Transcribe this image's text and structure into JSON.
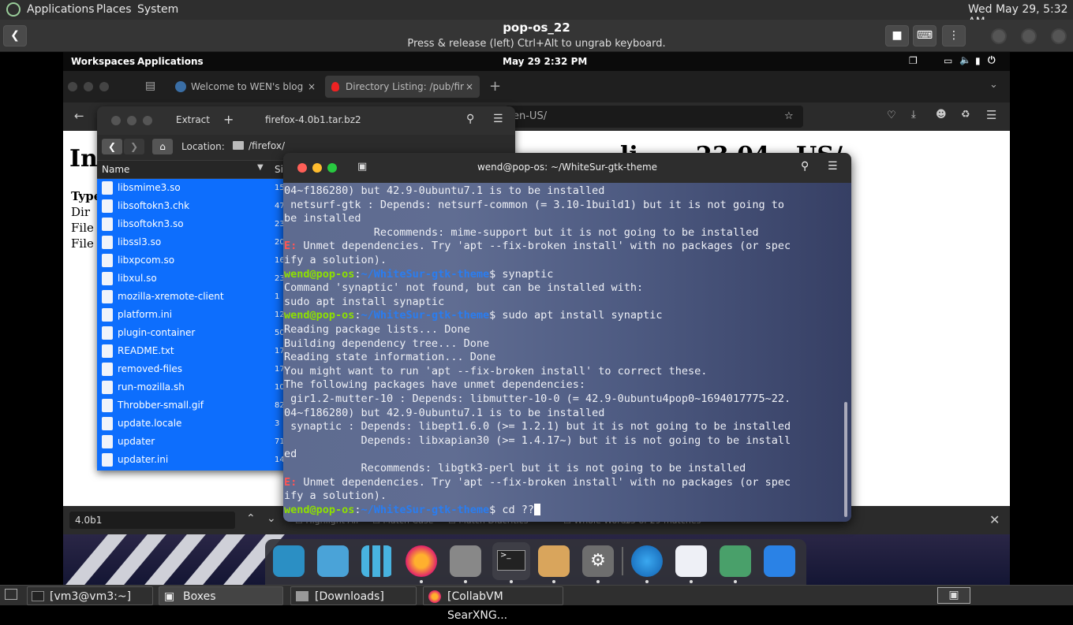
{
  "host_panel": {
    "menus": [
      "Applications",
      "Places",
      "System"
    ],
    "clock": "Wed May 29,  5:32 AM"
  },
  "boxes": {
    "title": "pop-os_22",
    "subtitle": "Press & release (left) Ctrl+Alt to ungrab keyboard."
  },
  "guest_panel": {
    "workspaces": "Workspaces",
    "applications": "Applications",
    "clock": "May 29   2:32 PM"
  },
  "firefox": {
    "tabs": [
      {
        "label": "Welcome to WEN's blog"
      },
      {
        "label": "Directory Listing: /pub/fir"
      }
    ],
    "url_tail": "en-US/",
    "page_heading_left": "In",
    "page_heading_right": "li       23.04 - US/",
    "type_label": "Type",
    "rows": [
      "Dir",
      "File",
      "File"
    ],
    "find": {
      "query": "4.0b1",
      "options": [
        "Highlight All",
        "Match Case",
        "Match Diacritics",
        "Whole Words"
      ],
      "count": "15 of 29 matches"
    }
  },
  "file_manager": {
    "extract_label": "Extract",
    "title": "firefox-4.0b1.tar.bz2",
    "location_label": "Location:",
    "location_path": "/firefox/",
    "col_name": "Name",
    "col_size": "Si",
    "files": [
      {
        "name": "libsmime3.so",
        "size": "15"
      },
      {
        "name": "libsoftokn3.chk",
        "size": "47"
      },
      {
        "name": "libsoftokn3.so",
        "size": "23"
      },
      {
        "name": "libssl3.so",
        "size": "20"
      },
      {
        "name": "libxpcom.so",
        "size": "16"
      },
      {
        "name": "libxul.so",
        "size": "23"
      },
      {
        "name": "mozilla-xremote-client",
        "size": "1"
      },
      {
        "name": "platform.ini",
        "size": "12"
      },
      {
        "name": "plugin-container",
        "size": "50"
      },
      {
        "name": "README.txt",
        "size": "17"
      },
      {
        "name": "removed-files",
        "size": "17"
      },
      {
        "name": "run-mozilla.sh",
        "size": "10"
      },
      {
        "name": "Throbber-small.gif",
        "size": "82"
      },
      {
        "name": "update.locale",
        "size": "3"
      },
      {
        "name": "updater",
        "size": "71"
      },
      {
        "name": "updater.ini",
        "size": "14"
      }
    ]
  },
  "terminal": {
    "title": "wend@pop-os: ~/WhiteSur-gtk-theme",
    "lines": [
      {
        "t": "04~f186280) but 42.9-0ubuntu7.1 is to be installed"
      },
      {
        "t": " netsurf-gtk : Depends: netsurf-common (= 3.10-1build1) but it is not going to"
      },
      {
        "t": "be installed"
      },
      {
        "t": "              Recommends: mime-support but it is not going to be installed"
      },
      {
        "e": "E:",
        "t": " Unmet dependencies. Try 'apt --fix-broken install' with no packages (or spec"
      },
      {
        "t": "ify a solution)."
      },
      {
        "u": "wend@pop-os",
        "p": "~/WhiteSur-gtk-theme",
        "t": "$ synaptic"
      },
      {
        "t": "Command 'synaptic' not found, but can be installed with:"
      },
      {
        "t": "sudo apt install synaptic"
      },
      {
        "u": "wend@pop-os",
        "p": "~/WhiteSur-gtk-theme",
        "t": "$ sudo apt install synaptic"
      },
      {
        "t": "Reading package lists... Done"
      },
      {
        "t": "Building dependency tree... Done"
      },
      {
        "t": "Reading state information... Done"
      },
      {
        "t": "You might want to run 'apt --fix-broken install' to correct these."
      },
      {
        "t": "The following packages have unmet dependencies:"
      },
      {
        "t": " gir1.2-mutter-10 : Depends: libmutter-10-0 (= 42.9-0ubuntu4pop0~1694017775~22."
      },
      {
        "t": "04~f186280) but 42.9-0ubuntu7.1 is to be installed"
      },
      {
        "t": " synaptic : Depends: libept1.6.0 (>= 1.2.1) but it is not going to be installed"
      },
      {
        "t": "            Depends: libxapian30 (>= 1.4.17~) but it is not going to be install"
      },
      {
        "t": "ed"
      },
      {
        "t": "            Recommends: libgtk3-perl but it is not going to be installed"
      },
      {
        "e": "E:",
        "t": " Unmet dependencies. Try 'apt --fix-broken install' with no packages (or spec"
      },
      {
        "t": "ify a solution)."
      },
      {
        "u": "wend@pop-os",
        "p": "~/WhiteSur-gtk-theme",
        "t": "$ cd ??"
      }
    ]
  },
  "taskbar": {
    "items": [
      "[vm3@vm3:~]",
      "Boxes",
      "[Downloads]",
      "[CollabVM SearXNG..."
    ]
  },
  "colors": {
    "selection_blue": "#0d6efd",
    "prompt_user": "#8ee000",
    "prompt_path": "#2a7df0",
    "error_red": "#ff5555"
  },
  "icons": {
    "dock": [
      "search-icon",
      "files-icon",
      "app-grid-icon",
      "firefox-icon",
      "folder-icon",
      "terminal-icon",
      "archive-icon",
      "settings-icon",
      "globe-icon",
      "toggle-icon",
      "zip-icon",
      "puzzle-icon"
    ]
  }
}
